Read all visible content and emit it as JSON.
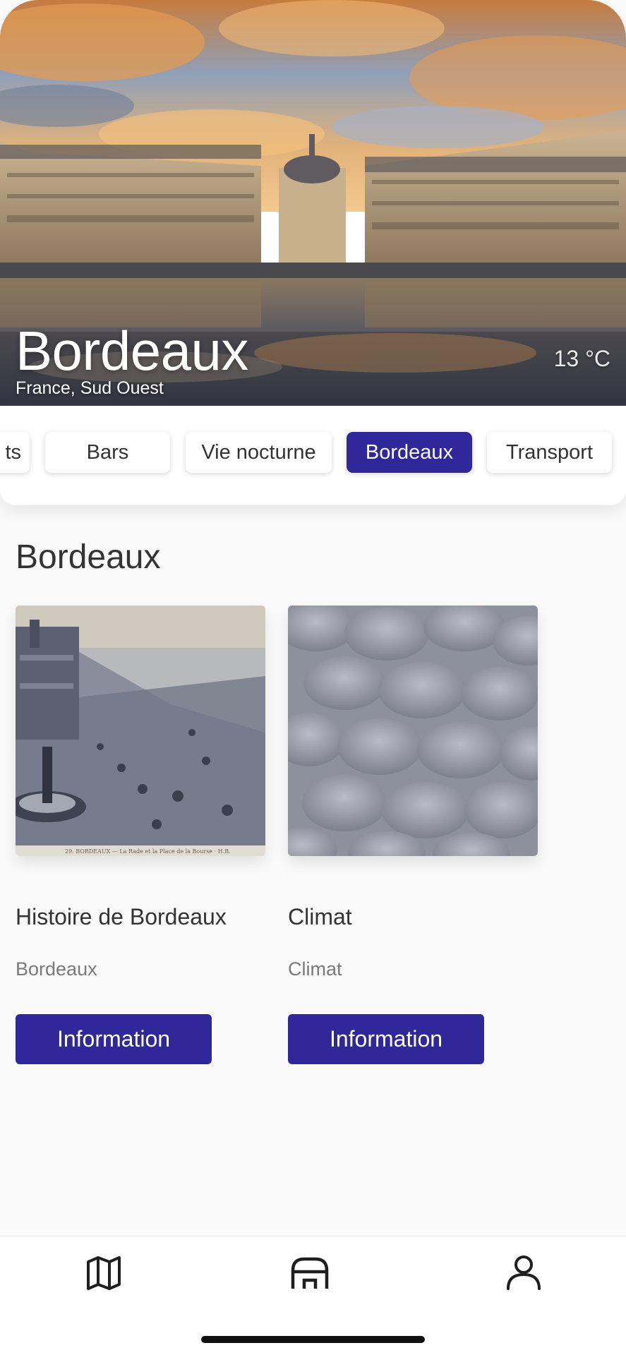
{
  "hero": {
    "title": "Bordeaux",
    "subtitle": "France, Sud Ouest",
    "temperature": "13 °C"
  },
  "chips": [
    {
      "label": "ts",
      "active": false
    },
    {
      "label": "Bars",
      "active": false
    },
    {
      "label": "Vie nocturne",
      "active": false
    },
    {
      "label": "Bordeaux",
      "active": true
    },
    {
      "label": "Transport",
      "active": false
    }
  ],
  "section": {
    "title": "Bordeaux",
    "cards": [
      {
        "title": "Histoire de Bordeaux",
        "subtitle": "Bordeaux",
        "button": "Information",
        "image": "vintage-postcard-bordeaux"
      },
      {
        "title": "Climat",
        "subtitle": "Climat",
        "button": "Information",
        "image": "mammatus-clouds"
      }
    ]
  },
  "tabbar": {
    "items": [
      {
        "icon": "map-icon"
      },
      {
        "icon": "store-icon"
      },
      {
        "icon": "user-icon"
      }
    ]
  },
  "colors": {
    "accent": "#30289a",
    "background": "#fbfafb",
    "text": "#333333",
    "muted": "#7a7a7a"
  }
}
